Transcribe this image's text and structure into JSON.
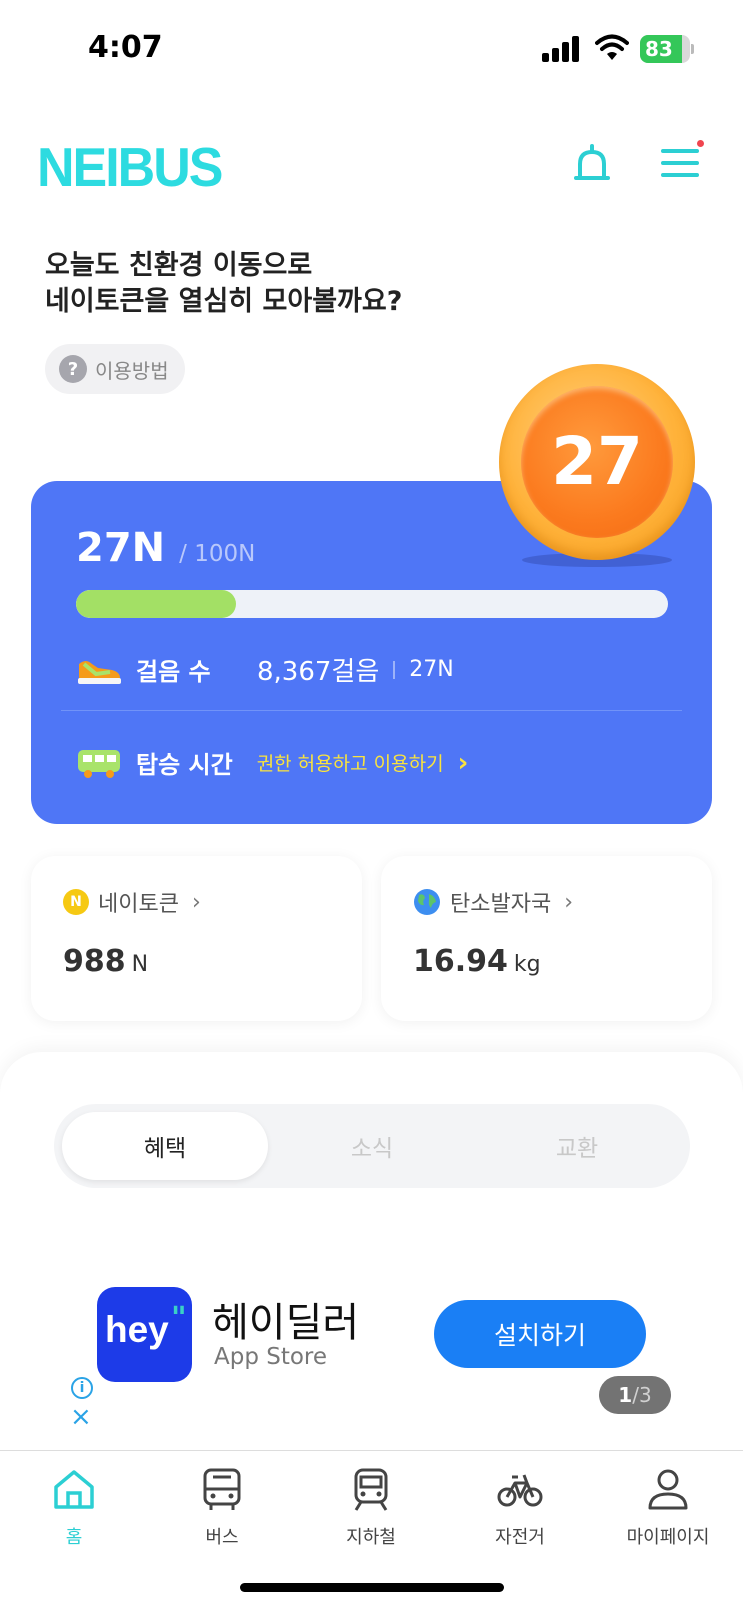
{
  "status_bar": {
    "time": "4:07",
    "battery": "83",
    "battery_level": 0.83
  },
  "header": {
    "logo": "NEIBUS"
  },
  "greeting": {
    "line1": "오늘도 친환경 이동으로",
    "line2": "네이토큰을 열심히 모아볼까요?"
  },
  "help_chip": {
    "icon": "?",
    "label": "이용방법"
  },
  "coin_badge": {
    "value": "27"
  },
  "progress": {
    "current": "27N",
    "max": "/ 100N",
    "fraction": 0.27,
    "steps_label": "걸음 수",
    "steps_value": "8,367걸음",
    "steps_n": "27N",
    "ride_label": "탑승 시간",
    "ride_link": "권한 허용하고 이용하기",
    "ride_chevron": "›"
  },
  "stats": {
    "token": {
      "icon": "N",
      "label": "네이토큰",
      "chevron": "›",
      "value": "988",
      "unit": "N"
    },
    "carbon": {
      "label": "탄소발자국",
      "chevron": "›",
      "value": "16.94",
      "unit": "kg"
    }
  },
  "tabs": [
    {
      "label": "혜택",
      "active": true
    },
    {
      "label": "소식",
      "active": false
    },
    {
      "label": "교환",
      "active": false
    }
  ],
  "ad": {
    "icon_text": "hey",
    "icon_quote": "\"",
    "title": "헤이딜러",
    "subtitle": "App Store",
    "install": "설치하기",
    "info": "i",
    "close": "×",
    "pager_current": "1",
    "pager_total": "/3"
  },
  "nav": [
    {
      "label": "홈",
      "icon": "home-icon",
      "active": true
    },
    {
      "label": "버스",
      "icon": "bus-icon",
      "active": false
    },
    {
      "label": "지하철",
      "icon": "subway-icon",
      "active": false
    },
    {
      "label": "자전거",
      "icon": "bicycle-icon",
      "active": false
    },
    {
      "label": "마이페이지",
      "icon": "person-icon",
      "active": false
    }
  ],
  "colors": {
    "brand": "#2ddbe0",
    "card_blue": "#4f76f6",
    "progress_green": "#a3e065",
    "link_yellow": "#f9e33e",
    "install_blue": "#1a7ff5"
  }
}
